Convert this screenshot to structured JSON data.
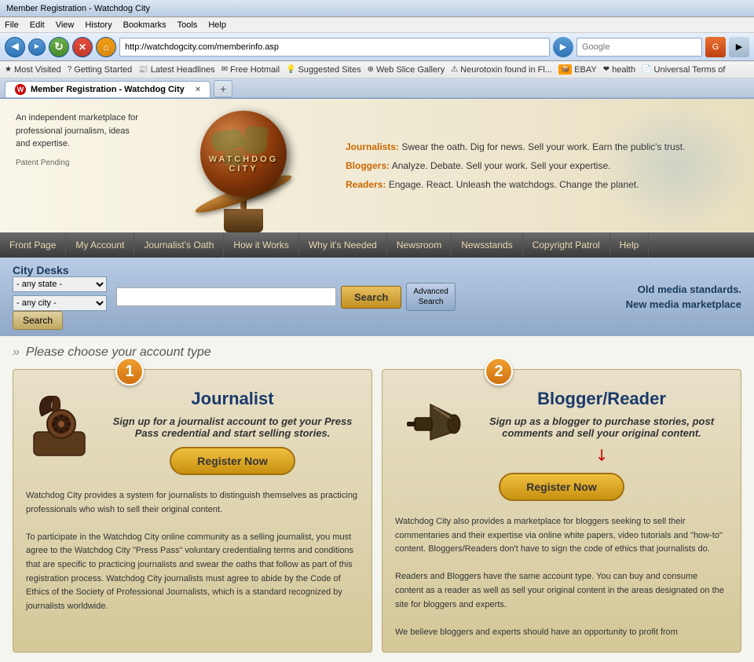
{
  "browser": {
    "title": "Member Registration - Watchdog City",
    "menu_items": [
      "File",
      "Edit",
      "View",
      "History",
      "Bookmarks",
      "Tools",
      "Help"
    ],
    "address": "http://watchdogcity.com/memberinfo.asp",
    "search_placeholder": "Google",
    "back_btn": "◄",
    "forward_btn": "►",
    "refresh_btn": "↻",
    "stop_btn": "✕",
    "home_btn": "⌂"
  },
  "favorites": [
    {
      "label": "Most Visited",
      "icon": "★"
    },
    {
      "label": "Getting Started",
      "icon": "?"
    },
    {
      "label": "Latest Headlines",
      "icon": "📰"
    },
    {
      "label": "Free Hotmail",
      "icon": "✉"
    },
    {
      "label": "Suggested Sites",
      "icon": "💡"
    },
    {
      "label": "Web Slice Gallery",
      "icon": "⊕"
    },
    {
      "label": "Neurotoxin found in Fl...",
      "icon": "⚠"
    },
    {
      "label": "EBAY",
      "icon": "📦"
    },
    {
      "label": "health",
      "icon": "❤"
    },
    {
      "label": "Universal Terms of",
      "icon": "📄"
    }
  ],
  "tab": {
    "label": "Member Registration - Watchdog City",
    "close": "×",
    "new_tab": "+"
  },
  "header": {
    "tagline_journalist_label": "Journalists:",
    "tagline_journalist_text": " Swear the oath. Dig for news. Sell your work. Earn the public's trust.",
    "tagline_blogger_label": "Bloggers:",
    "tagline_blogger_text": " Analyze. Debate. Sell your work. Sell your expertise.",
    "tagline_reader_label": "Readers:",
    "tagline_reader_text": " Engage. React. Unleash the watchdogs. Change the planet.",
    "description": "An independent marketplace for professional journalism, ideas and expertise.",
    "patent": "Patent Pending",
    "globe_text": "WATCHDOG CITY"
  },
  "nav": {
    "items": [
      "Front Page",
      "My Account",
      "Journalist's Oath",
      "How it Works",
      "Why it's Needed",
      "Newsroom",
      "Newsstands",
      "Copyright Patrol",
      "Help"
    ]
  },
  "city_desks": {
    "label": "City Desks",
    "state_default": "- any state -",
    "city_default": "- any city -",
    "search_btn": "Search",
    "search_placeholder": "",
    "main_search_btn": "Search",
    "advanced_search_line1": "Advanced",
    "advanced_search_line2": "Search",
    "old_media_line1": "Old media standards.",
    "old_media_line2": "New media marketplace"
  },
  "account_section": {
    "title": "Please choose your account type",
    "journalist_card": {
      "number": "1",
      "title": "Journalist",
      "subtitle": "Sign up for a journalist account to get your Press Pass credential and start selling stories.",
      "register_btn": "Register Now",
      "body_text": "Watchdog City provides a system for journalists to distinguish themselves as practicing professionals who wish to sell their original content.\n\nTo participate in the Watchdog City online community as a selling journalist, you must agree to the Watchdog City \"Press Pass\" voluntary credentialing terms and conditions that are specific to practicing journalists and swear the oaths that follow as part of this registration process. Watchdog City journalists must agree to abide by the Code of Ethics of the Society of Professional Journalists, which is a standard recognized by journalists worldwide."
    },
    "blogger_card": {
      "number": "2",
      "title": "Blogger/Reader",
      "subtitle": "Sign up as a blogger to purchase stories, post comments and sell your original content.",
      "register_btn": "Register Now",
      "body_text": "Watchdog City also provides a marketplace for bloggers seeking to sell their commentaries and their expertise via online white papers, video tutorials and \"how-to\" content. Bloggers/Readers don't have to sign the code of ethics that journalists do.\n\nReaders and Bloggers have the same account type. You can buy and consume content as a reader as well as sell your original content in the areas designated on the site for bloggers and experts.\n\nWe believe bloggers and experts should have an opportunity to profit from"
    }
  }
}
